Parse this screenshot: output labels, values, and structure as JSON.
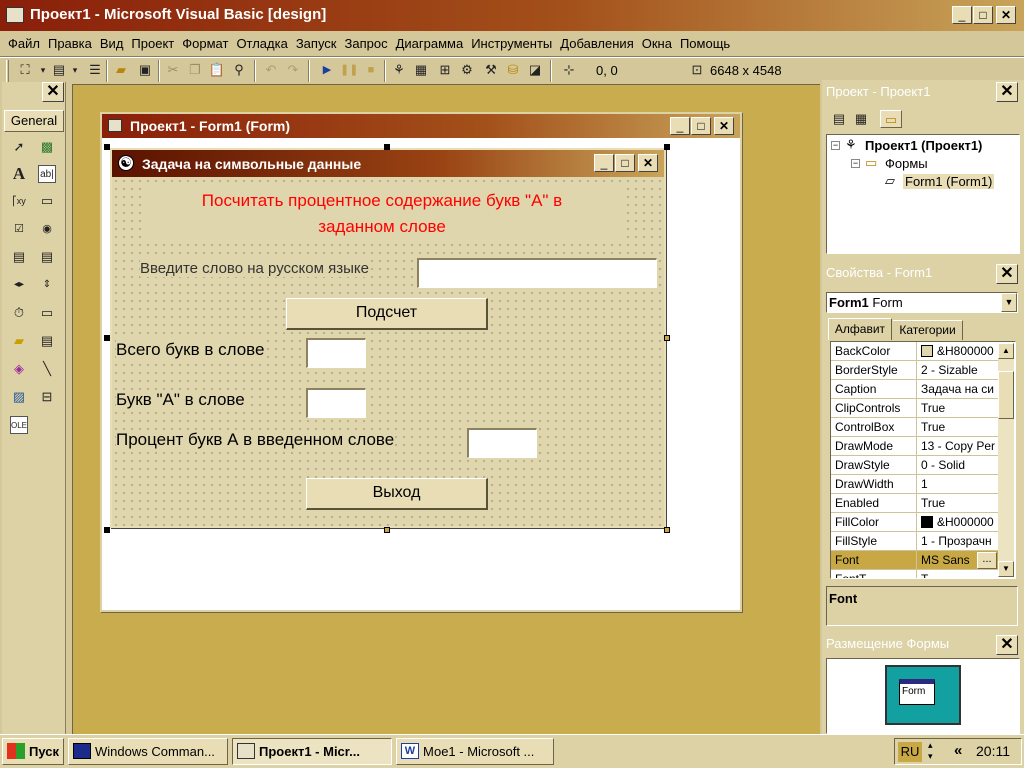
{
  "app": {
    "title": "Проект1 - Microsoft Visual Basic [design]"
  },
  "menu": [
    "Файл",
    "Правка",
    "Вид",
    "Проект",
    "Формат",
    "Отладка",
    "Запуск",
    "Запрос",
    "Диаграмма",
    "Инструменты",
    "Добавления",
    "Окна",
    "Помощь"
  ],
  "toolbar": {
    "position": "0, 0",
    "size": "6648 x 4548"
  },
  "toolbox": {
    "title": "General"
  },
  "form_window": {
    "title": "Проект1 - Form1 (Form)"
  },
  "form": {
    "caption": "Задача на символьные данные",
    "heading_line1": "Посчитать процентное содержание букв \"А\" в",
    "heading_line2": "заданном слове",
    "prompt_label": "Введите слово на русском языке",
    "count_button": "Подсчет",
    "total_label": "Всего букв в слове",
    "a_label": "Букв \"А\" в слове",
    "percent_label": "Процент букв А в введенном слове",
    "exit_button": "Выход",
    "heading_color": "#ff0000"
  },
  "project_panel": {
    "title": "Проект - Проект1",
    "root": "Проект1 (Проект1)",
    "folder": "Формы",
    "item": "Form1 (Form1)"
  },
  "properties_panel": {
    "title": "Свойства - Form1",
    "object_bold": "Form1",
    "object_type": "Form",
    "tab_alpha": "Алфавит",
    "tab_categories": "Категории",
    "rows": [
      {
        "name": "BackColor",
        "value": "&H800000"
      },
      {
        "name": "BorderStyle",
        "value": "2 - Sizable"
      },
      {
        "name": "Caption",
        "value": "Задача на си"
      },
      {
        "name": "ClipControls",
        "value": "True"
      },
      {
        "name": "ControlBox",
        "value": "True"
      },
      {
        "name": "DrawMode",
        "value": "13 - Copy Per"
      },
      {
        "name": "DrawStyle",
        "value": "0 - Solid"
      },
      {
        "name": "DrawWidth",
        "value": "1"
      },
      {
        "name": "Enabled",
        "value": "True"
      },
      {
        "name": "FillColor",
        "value": "&H000000"
      },
      {
        "name": "FillStyle",
        "value": "1 - Прозрачн"
      },
      {
        "name": "Font",
        "value": "MS Sans"
      },
      {
        "name": "FontT",
        "value": "T"
      }
    ],
    "description_title": "Font"
  },
  "layout_panel": {
    "title": "Размещение Формы",
    "preview_label": "Form"
  },
  "taskbar": {
    "start": "Пуск",
    "buttons": [
      "Windows Comman...",
      "Проект1 - Micr...",
      "Мое1 - Microsoft ..."
    ],
    "lang": "RU",
    "arrows": "«",
    "clock": "20:11"
  }
}
